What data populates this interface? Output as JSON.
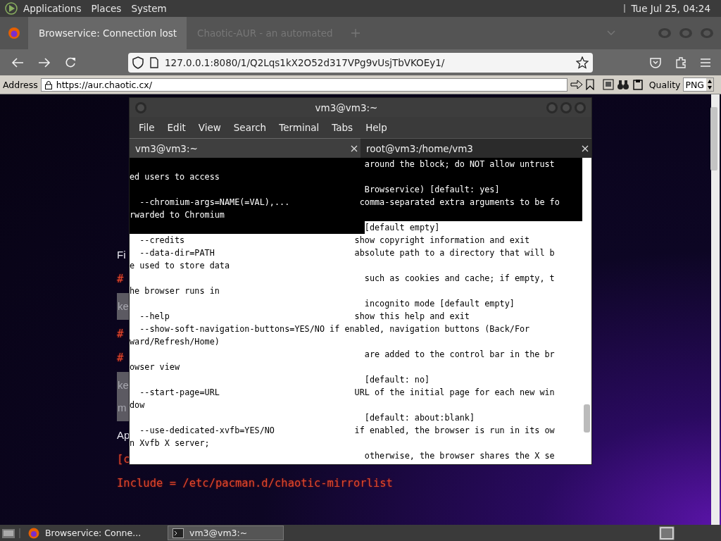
{
  "top_panel": {
    "menus": [
      "Applications",
      "Places",
      "System"
    ],
    "clock": "Tue Jul 25, 04:24"
  },
  "browser": {
    "tabs": [
      {
        "title": "Browservice: Connection lost",
        "selected": true
      },
      {
        "title": "Chaotic-AUR - an automated",
        "selected": false
      }
    ],
    "url": "127.0.0.1:8080/1/Q2Lqs1kX2O52d317VPg9vUsjTbVKOEy1/"
  },
  "browservice_toolbar": {
    "address_label": "Address",
    "address": "https://aur.chaotic.cx/",
    "quality_label": "Quality",
    "quality": "PNG"
  },
  "page": {
    "items": [
      {
        "kind": "text",
        "lines": [
          "Fi"
        ]
      },
      {
        "kind": "comment",
        "lines": [
          "#"
        ]
      },
      {
        "kind": "code",
        "lines": [
          "ke"
        ]
      },
      {
        "kind": "comment",
        "lines": [
          "#"
        ]
      },
      {
        "kind": "comment",
        "lines": [
          "#"
        ]
      },
      {
        "kind": "code",
        "lines": [
          "ke",
          "m"
        ]
      },
      {
        "kind": "text",
        "lines": [
          "Ap"
        ]
      },
      {
        "kind": "comment",
        "lines": [
          "[c"
        ]
      },
      {
        "kind": "comment",
        "lines": [
          "Include = /etc/pacman.d/chaotic-mirrorlist"
        ]
      }
    ]
  },
  "terminal": {
    "title": "vm3@vm3:~",
    "menus": [
      "File",
      "Edit",
      "View",
      "Search",
      "Terminal",
      "Tabs",
      "Help"
    ],
    "tabs": [
      {
        "title": "vm3@vm3:~",
        "selected": true
      },
      {
        "title": "root@vm3:/home/vm3",
        "selected": false
      }
    ],
    "lines": [
      {
        "kind": "dark",
        "text": "                                               around the block; do NOT allow untrust"
      },
      {
        "kind": "dark",
        "text": "ed users to access"
      },
      {
        "kind": "dark",
        "text": "                                               Browservice) [default: yes]"
      },
      {
        "kind": "dark",
        "text": "  --chromium-args=NAME(=VAL),...              comma-separated extra arguments to be fo"
      },
      {
        "kind": "dark",
        "text": "rwarded to Chromium"
      },
      {
        "kind": "split",
        "text": "                                               [default empty]"
      },
      {
        "kind": "light",
        "text": "  --credits                                  show copyright information and exit"
      },
      {
        "kind": "light",
        "text": "  --data-dir=PATH                            absolute path to a directory that will b"
      },
      {
        "kind": "light",
        "text": "e used to store data"
      },
      {
        "kind": "light",
        "text": "                                               such as cookies and cache; if empty, t"
      },
      {
        "kind": "light",
        "text": "he browser runs in"
      },
      {
        "kind": "light",
        "text": "                                               incognito mode [default empty]"
      },
      {
        "kind": "light",
        "text": "  --help                                     show this help and exit"
      },
      {
        "kind": "light",
        "text": "  --show-soft-navigation-buttons=YES/NO if enabled, navigation buttons (Back/For"
      },
      {
        "kind": "light",
        "text": "ward/Refresh/Home)"
      },
      {
        "kind": "light",
        "text": "                                               are added to the control bar in the br"
      },
      {
        "kind": "light",
        "text": "owser view"
      },
      {
        "kind": "light",
        "text": "                                               [default: no]"
      },
      {
        "kind": "light",
        "text": "  --start-page=URL                           URL of the initial page for each new win"
      },
      {
        "kind": "light",
        "text": "dow"
      },
      {
        "kind": "light",
        "text": "                                               [default: about:blank]"
      },
      {
        "kind": "light",
        "text": "  --use-dedicated-xvfb=YES/NO                if enabled, the browser is run in its ow"
      },
      {
        "kind": "light",
        "text": "n Xvfb X server;"
      },
      {
        "kind": "light",
        "text": "                                               otherwise, the browser shares the X se"
      }
    ]
  },
  "taskbar": {
    "items": [
      {
        "kind": "browser",
        "label": "Browservice: Conne...",
        "selected": false
      },
      {
        "kind": "terminal",
        "label": "vm3@vm3:~",
        "selected": true
      }
    ]
  }
}
